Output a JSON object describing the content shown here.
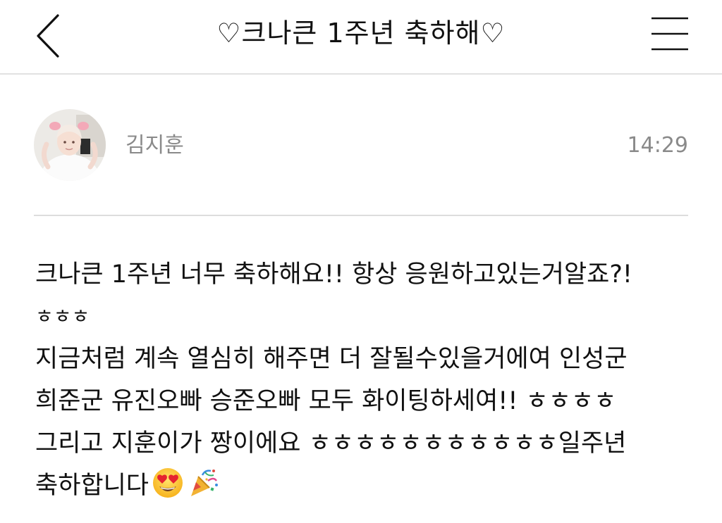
{
  "header": {
    "title": "♡크나큰 1주년 축하해♡",
    "back_icon": "chevron-left-icon",
    "menu_icon": "hamburger-menu-icon"
  },
  "post": {
    "author": "김지훈",
    "time": "14:29",
    "lines": [
      "크나큰 1주년 너무 축하해요!! 항상 응원하고있는거알죠?!",
      "ㅎㅎㅎ",
      "지금처럼 계속 열심히 해주면 더 잘될수있을거에여 인성군",
      "희준군 유진오빠 승준오빠 모두 화이팅하세여!! ㅎㅎㅎㅎ",
      "그리고 지훈이가 짱이에요 ㅎㅎㅎㅎㅎㅎㅎㅎㅎㅎㅎ일주년",
      "축하합니다"
    ],
    "trailing_emojis": [
      "heart-eyes-emoji",
      "party-popper-emoji"
    ]
  },
  "colors": {
    "text": "#111111",
    "meta_gray": "#8a8a8a",
    "divider": "#dddddd"
  }
}
